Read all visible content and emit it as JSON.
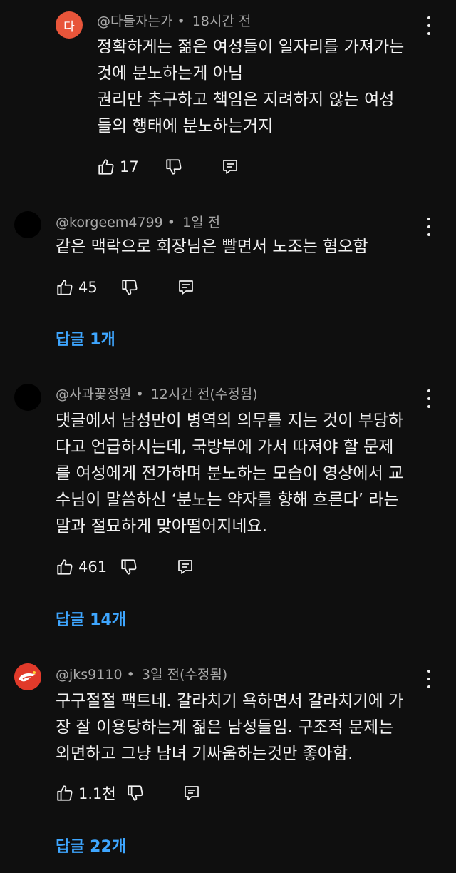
{
  "comments": [
    {
      "avatar_letter": "다",
      "author": "@다들자는가",
      "separator": "•",
      "time": "18시간 전",
      "lines": [
        "정확하게는 젊은 여성들이 일자리를 가져가는",
        "것에 분노하는게 아님",
        "권리만 추구하고 책임은 지려하지 않는 여성",
        "들의 행태에 분노하는거지"
      ],
      "likes": "17",
      "replies_label": ""
    },
    {
      "author": "@korgeem4799",
      "separator": "•",
      "time": "1일 전",
      "lines": [
        "같은 맥락으로 회장님은 빨면서 노조는 혐오함"
      ],
      "likes": "45",
      "replies_label": "답글 1개"
    },
    {
      "author": "@사과꽃정원",
      "separator": "•",
      "time": "12시간 전(수정됨)",
      "lines": [
        "댓글에서 남성만이 병역의 의무를 지는 것이 부당하",
        "다고 언급하시는데, 국방부에 가서 따져야 할 문제",
        "를 여성에게 전가하며 분노하는 모습이 영상에서 교",
        "수님이 말씀하신 ‘분노는 약자를 향해 흐른다’ 라는",
        "말과 절묘하게 맞아떨어지네요."
      ],
      "likes": "461",
      "replies_label": "답글 14개"
    },
    {
      "author": "@jks9110",
      "separator": "•",
      "time": "3일 전(수정됨)",
      "lines": [
        "구구절절 팩트네. 갈라치기 욕하면서 갈라치기에 가",
        "장 잘 이용당하는게 젊은 남성들임. 구조적 문제는",
        "외면하고 그냥 남녀 기싸움하는것만 좋아함."
      ],
      "likes": "1.1천",
      "replies_label": "답글 22개"
    }
  ],
  "colors": {
    "background": "#0f0f0f",
    "text": "#f1f1f1",
    "meta": "#aaaaaa",
    "link": "#3ea6ff",
    "avatar_orange": "#e8553a"
  },
  "icons": [
    "like-icon",
    "dislike-icon",
    "reply-icon",
    "more-vert-icon"
  ]
}
